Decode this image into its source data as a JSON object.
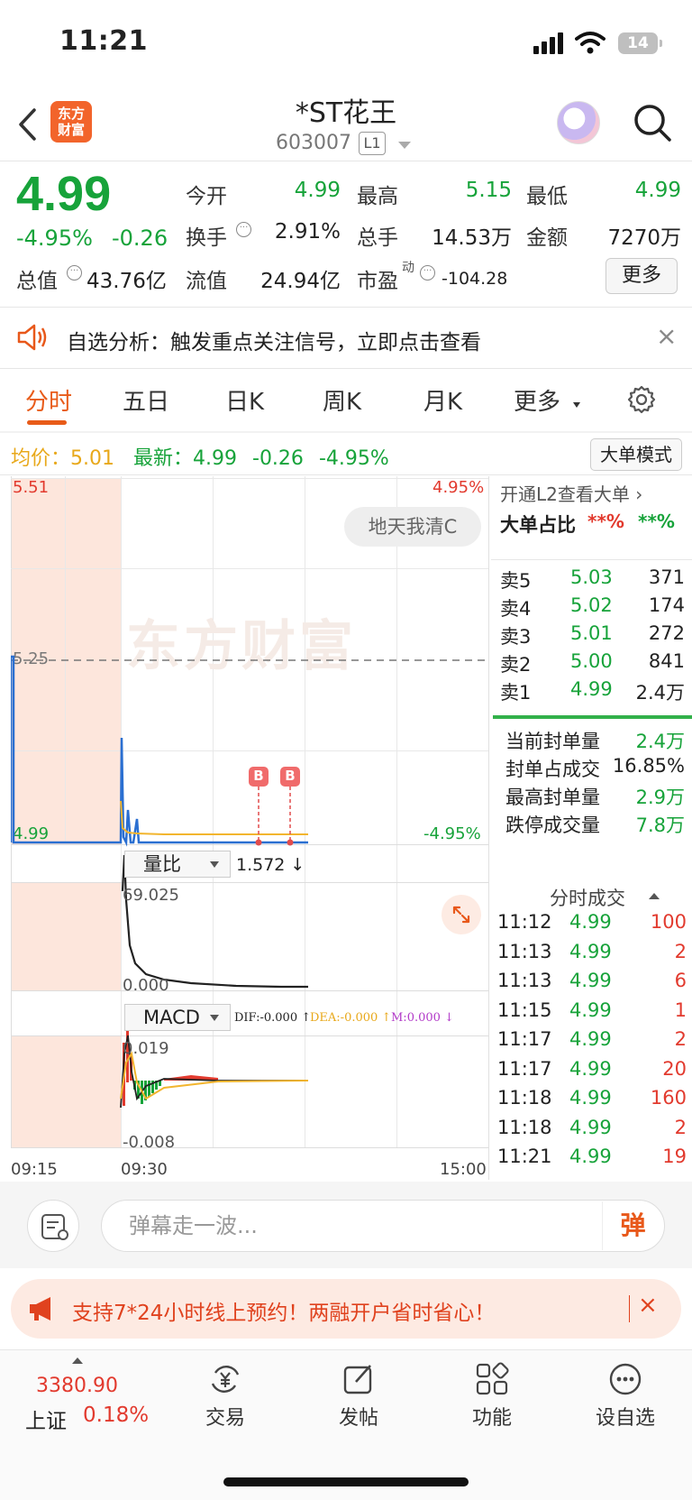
{
  "status": {
    "time": "11:21",
    "battery": "14"
  },
  "header": {
    "logo": "东方\n财富",
    "title": "*ST花王",
    "code": "603007",
    "level": "L1"
  },
  "quote": {
    "price": "4.99",
    "pct": "-4.95%",
    "chg": "-0.26",
    "open_label": "今开",
    "open": "4.99",
    "high_label": "最高",
    "high": "5.15",
    "low_label": "最低",
    "low": "4.99",
    "turnover_label": "换手",
    "turnover": "2.91%",
    "vol_label": "总手",
    "vol": "14.53万",
    "amt_label": "金额",
    "amt": "7270万",
    "mcap_label": "总值",
    "mcap": "43.76亿",
    "fcap_label": "流值",
    "fcap": "24.94亿",
    "pe_label": "市盈",
    "pe_sup": "动",
    "pe": "-104.28",
    "more": "更多"
  },
  "notice": {
    "text": "自选分析：触发重点关注信号，立即点击查看",
    "close": "×"
  },
  "tabs": [
    "分时",
    "五日",
    "日K",
    "周K",
    "月K",
    "更多"
  ],
  "priceline": {
    "avg_label": "均价：",
    "avg": "5.01",
    "latest_label": "最新：",
    "latest": "4.99",
    "chg": "-0.26",
    "pct": "-4.95%",
    "mode_btn": "大单模式"
  },
  "chart": {
    "y_top": "5.51",
    "y_mid": "5.25",
    "y_bot": "4.99",
    "pct_top": "4.95%",
    "pct_bot": "-4.95%",
    "tip": "地天我清C",
    "watermark": "东方财富",
    "b_marker": "B",
    "vol_selector": "量比",
    "vol_value": "1.572 ↓",
    "vol_top": "69.025",
    "vol_bot": "0.000",
    "macd_selector": "MACD",
    "dif": "DIF:-0.000 ↑",
    "dea": "DEA:-0.000 ↑",
    "m": "M:0.000 ↓",
    "macd_top": "0.019",
    "macd_bot": "-0.008",
    "x_start": "09:15",
    "x_open": "09:30",
    "x_end": "15:00"
  },
  "chart_data": {
    "type": "line",
    "x_labels": [
      "09:15",
      "09:30",
      "15:00"
    ],
    "ylim": [
      4.99,
      5.51
    ],
    "reference": 5.25,
    "series": [
      {
        "name": "价格",
        "color": "#2a6fd1"
      },
      {
        "name": "均价",
        "color": "#f2b52e"
      }
    ],
    "volume_ratio_ylim": [
      0.0,
      69.025
    ],
    "macd_ylim": [
      -0.008,
      0.019
    ]
  },
  "right_panel": {
    "l2_link": "开通L2查看大单 ›",
    "big_ratio_label": "大单占比",
    "big_ratio_a": "**%",
    "big_ratio_b": "**%",
    "asks": [
      {
        "label": "卖5",
        "price": "5.03",
        "vol": "371"
      },
      {
        "label": "卖4",
        "price": "5.02",
        "vol": "174"
      },
      {
        "label": "卖3",
        "price": "5.01",
        "vol": "272"
      },
      {
        "label": "卖2",
        "price": "5.00",
        "vol": "841"
      },
      {
        "label": "卖1",
        "price": "4.99",
        "vol": "2.4万"
      }
    ],
    "seal": [
      {
        "label": "当前封单量",
        "value": "2.4万"
      },
      {
        "label": "封单占成交",
        "value": "16.85%"
      },
      {
        "label": "最高封单量",
        "value": "2.9万"
      },
      {
        "label": "跌停成交量",
        "value": "7.8万"
      }
    ],
    "ticks_title": "分时成交",
    "ticks": [
      {
        "time": "11:12",
        "price": "4.99",
        "vol": "100"
      },
      {
        "time": "11:13",
        "price": "4.99",
        "vol": "2"
      },
      {
        "time": "11:13",
        "price": "4.99",
        "vol": "6"
      },
      {
        "time": "11:15",
        "price": "4.99",
        "vol": "1"
      },
      {
        "time": "11:17",
        "price": "4.99",
        "vol": "2"
      },
      {
        "time": "11:17",
        "price": "4.99",
        "vol": "20"
      },
      {
        "time": "11:18",
        "price": "4.99",
        "vol": "160"
      },
      {
        "time": "11:18",
        "price": "4.99",
        "vol": "2"
      },
      {
        "time": "11:21",
        "price": "4.99",
        "vol": "19"
      }
    ]
  },
  "input": {
    "placeholder": "弹幕走一波...",
    "send": "弹"
  },
  "promo": {
    "text": "支持7*24小时线上预约！两融开户省时省心！",
    "close": "×"
  },
  "nav": {
    "index_value": "3380.90",
    "index_name": "上证",
    "index_pct": "0.18%",
    "items": [
      "交易",
      "发帖",
      "功能",
      "设自选"
    ]
  },
  "colors": {
    "up": "#e23a2e",
    "down": "#17a33a",
    "accent": "#e85b19",
    "premarket": "#fde6dc"
  }
}
